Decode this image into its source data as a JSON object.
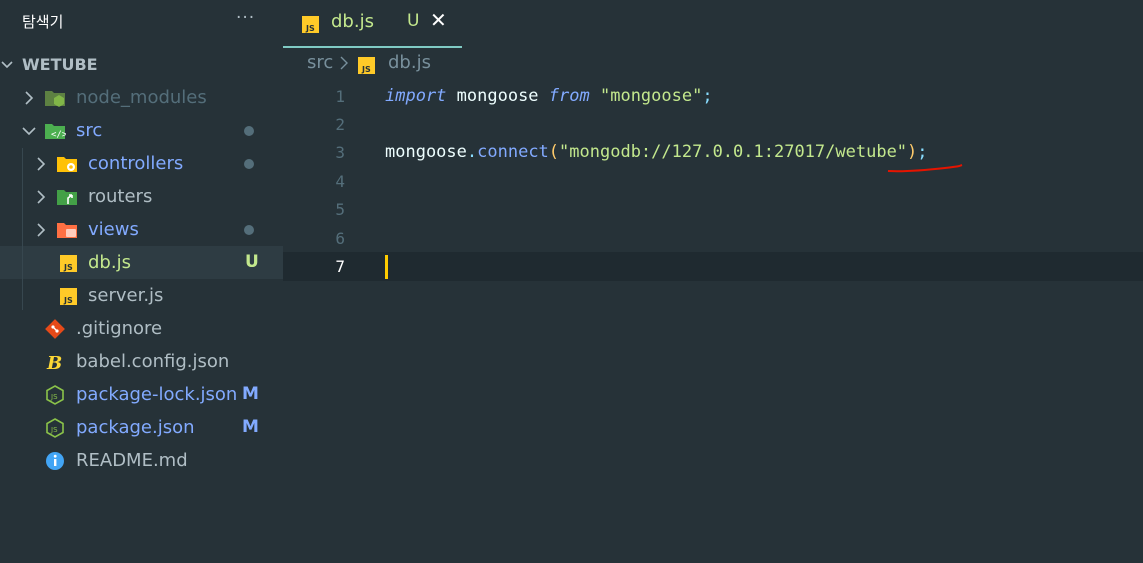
{
  "sidebar": {
    "title": "탐색기",
    "more": "···",
    "project": "WETUBE",
    "items": [
      {
        "label": "node_modules",
        "badge": ""
      },
      {
        "label": "src",
        "badge": ""
      },
      {
        "label": "controllers",
        "badge": ""
      },
      {
        "label": "routers",
        "badge": ""
      },
      {
        "label": "views",
        "badge": ""
      },
      {
        "label": "db.js",
        "badge": "U"
      },
      {
        "label": "server.js",
        "badge": ""
      },
      {
        "label": ".gitignore",
        "badge": ""
      },
      {
        "label": "babel.config.json",
        "badge": ""
      },
      {
        "label": "package-lock.json",
        "badge": "M"
      },
      {
        "label": "package.json",
        "badge": "M"
      },
      {
        "label": "README.md",
        "badge": ""
      }
    ]
  },
  "tab": {
    "label": "db.js",
    "status": "U",
    "close": "✕"
  },
  "breadcrumb": {
    "folder": "src",
    "file": "db.js"
  },
  "editor": {
    "line_numbers": [
      "1",
      "2",
      "3",
      "4",
      "5",
      "6",
      "7"
    ],
    "line1": {
      "kw_import": "import",
      "name": " mongoose ",
      "kw_from": "from",
      "sp": " ",
      "str": "\"mongoose\"",
      "semi": ";"
    },
    "line3": {
      "obj": "mongoose",
      "dot": ".",
      "fn": "connect",
      "lp": "(",
      "str": "\"mongodb://127.0.0.1:27017/wetube\"",
      "rp": ")",
      "semi": ";"
    }
  },
  "colors": {
    "background": "#263238",
    "accent": "#80cbc4",
    "untracked": "#c3e88d",
    "modified": "#82aaff",
    "squiggle": "#e51400"
  }
}
